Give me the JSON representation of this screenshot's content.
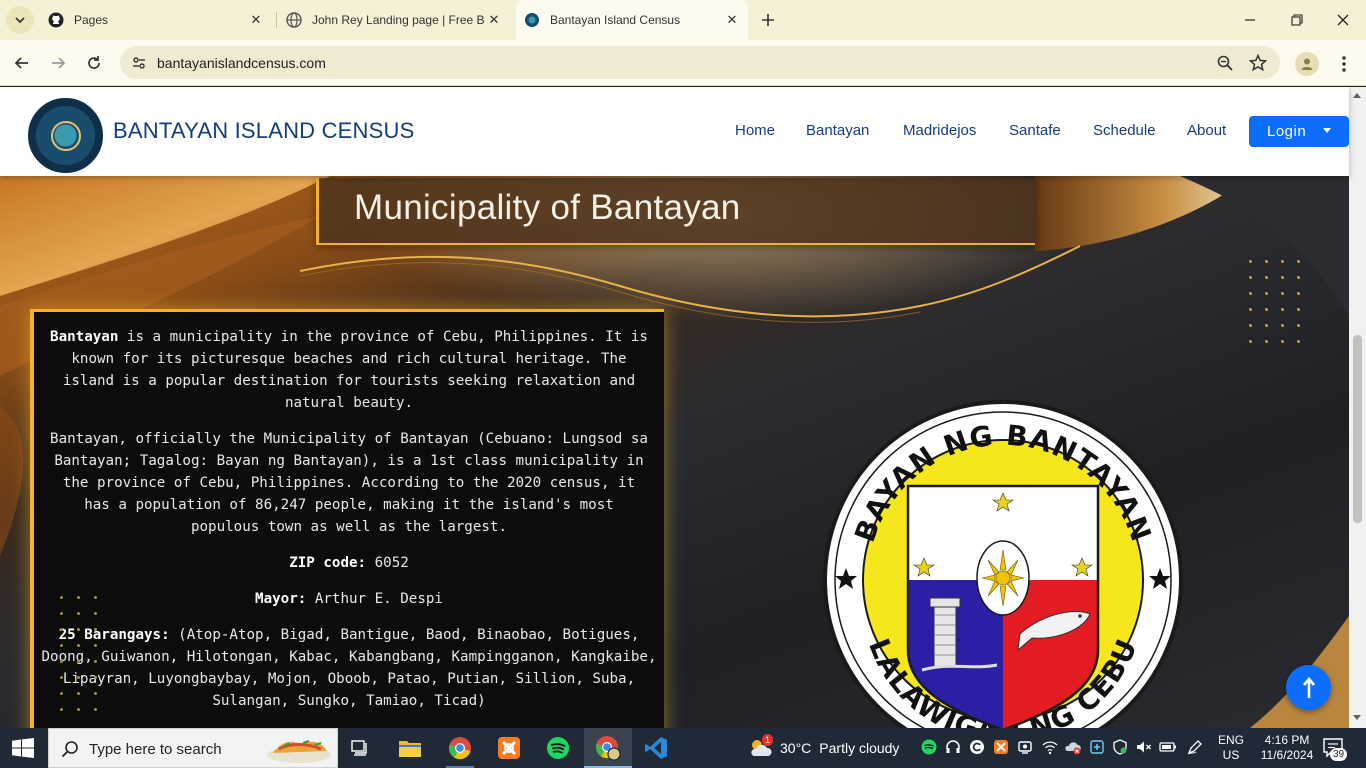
{
  "browser": {
    "tabs": [
      {
        "title": "Pages",
        "icon": "github-icon"
      },
      {
        "title": "John Rey Landing page | Free B",
        "icon": "globe-icon"
      },
      {
        "title": "Bantayan Island Census",
        "icon": "site-favicon",
        "active": true
      }
    ],
    "url": "bantayanislandcensus.com"
  },
  "site": {
    "brand": "BANTAYAN ISLAND CENSUS",
    "nav": [
      "Home",
      "Bantayan",
      "Madridejos",
      "Santafe",
      "Schedule",
      "About"
    ],
    "login_label": "Login",
    "hero_title": "Municipality of Bantayan",
    "card": {
      "intro_bold": "Bantayan",
      "intro_rest": " is a municipality in the province of Cebu, Philippines. It is known for its picturesque beaches and rich cultural heritage. The island is a popular destination for tourists seeking relaxation and natural beauty.",
      "official": "Bantayan, officially the Municipality of Bantayan (Cebuano: Lungsod sa Bantayan; Tagalog: Bayan ng Bantayan), is a 1st class municipality in the province of Cebu, Philippines. According to the 2020 census, it has a population of 86,247 people, making it the island's most populous town as well as the largest.",
      "zip_label": "ZIP code:",
      "zip_value": " 6052",
      "mayor_label": "Mayor:",
      "mayor_value": " Arthur E. Despi",
      "barangays_label": "25 Barangays:",
      "barangays_value": " (Atop-Atop, Bigad, Bantigue, Baod, Binaobao, Botigues, Doong, Guiwanon, Hilotongan, Kabac, Kabangbang, Kampingganon, Kangkaibe, Lipayran, Luyongbaybay, Mojon, Oboob, Patao, Putian, Sillion, Suba, Sulangan, Sungko, Tamiao, Ticad)"
    },
    "seal": {
      "top_text": "BAYAN NG BANTAYAN",
      "bottom_text": "LALAWIGAN NG CEBU"
    }
  },
  "taskbar": {
    "search_placeholder": "Type here to search",
    "weather_temp": "30°C",
    "weather_desc": "Partly cloudy",
    "lang_line1": "ENG",
    "lang_line2": "US",
    "time": "4:16 PM",
    "date": "11/6/2024",
    "notification_count": "39",
    "weather_badge": "1"
  },
  "colors": {
    "accent_gold": "#f2b230",
    "brand_blue": "#143d79",
    "login_blue": "#0d6efd",
    "seal_yellow": "#f6e71c",
    "seal_red": "#e31b23",
    "seal_blue": "#2a1fa5"
  }
}
